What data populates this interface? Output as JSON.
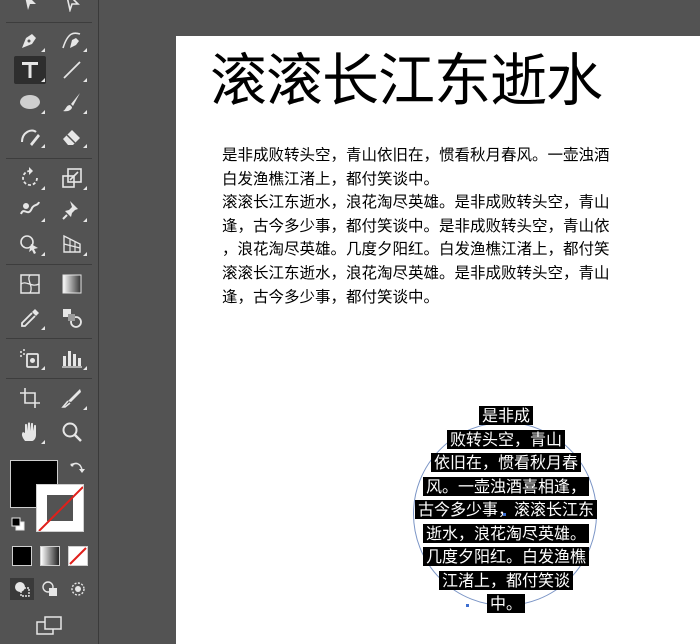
{
  "toolbar": {
    "tools": [
      {
        "name": "pen-tool",
        "active": false
      },
      {
        "name": "curvature-tool",
        "active": false
      },
      {
        "name": "type-tool",
        "active": true
      },
      {
        "name": "line-segment-tool",
        "active": false
      },
      {
        "name": "ellipse-tool",
        "active": false
      },
      {
        "name": "paintbrush-tool",
        "active": false
      },
      {
        "name": "shaper-tool",
        "active": false
      },
      {
        "name": "eraser-tool",
        "active": false
      },
      {
        "name": "rotate-tool",
        "active": false
      },
      {
        "name": "scale-tool",
        "active": false
      },
      {
        "name": "warp-tool",
        "active": false
      },
      {
        "name": "puppet-warp-tool",
        "active": false
      },
      {
        "name": "shape-builder-tool",
        "active": false
      },
      {
        "name": "perspective-grid-tool",
        "active": false
      },
      {
        "name": "mesh-tool",
        "active": false
      },
      {
        "name": "gradient-tool",
        "active": false
      },
      {
        "name": "eyedropper-tool",
        "active": false
      },
      {
        "name": "blend-tool",
        "active": false
      },
      {
        "name": "symbol-sprayer-tool",
        "active": false
      },
      {
        "name": "column-graph-tool",
        "active": false
      },
      {
        "name": "artboard-tool",
        "active": false
      },
      {
        "name": "slice-tool",
        "active": false
      },
      {
        "name": "hand-tool",
        "active": false
      },
      {
        "name": "zoom-tool",
        "active": false
      }
    ],
    "fill_color": "#000000",
    "stroke_color": "none"
  },
  "document": {
    "headline": "滚滚长江东逝水",
    "paragraph_lines": [
      "是非成败转头空，青山依旧在，惯看秋月春风。一壶浊酒",
      "白发渔樵江渚上，都付笑谈中。",
      "滚滚长江东逝水，浪花淘尽英雄。是非成败转头空，青山",
      "逢，古今多少事，都付笑谈中。是非成败转头空，青山依",
      "，浪花淘尽英雄。几度夕阳红。白发渔樵江渚上，都付笑",
      "滚滚长江东逝水，浪花淘尽英雄。是非成败转头空，青山",
      "逢，古今多少事，都付笑谈中。"
    ],
    "circle_text_lines": [
      "是非成",
      "败转头空，青山",
      "依旧在，惯看秋月春",
      "风。一壶浊酒喜相逢，",
      "古今多少事，滚滚长江东",
      "逝水，浪花淘尽英雄。",
      "几度夕阳红。白发渔樵",
      "江渚上，都付笑谈",
      "中。"
    ]
  },
  "colors": {
    "workspace": "#535353",
    "selection_highlight": "#000000",
    "path_outline": "#7b95c6"
  }
}
